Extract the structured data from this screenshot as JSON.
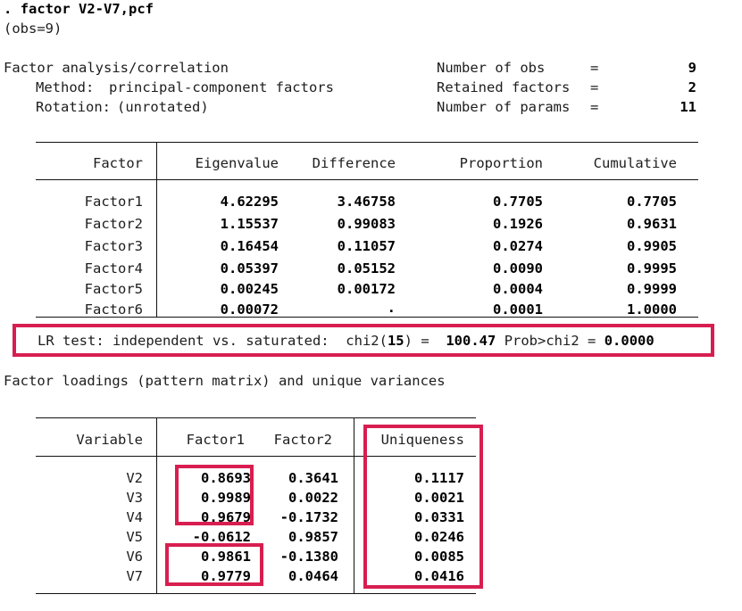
{
  "command": {
    "prompt": ".",
    "text": "factor V2-V7,pcf",
    "obs_line": "(obs=9)"
  },
  "summary": {
    "title": "Factor analysis/correlation",
    "method_label": "Method:",
    "method_value": "principal-component factors",
    "rotation_label": "Rotation:",
    "rotation_value": "(unrotated)",
    "stats": [
      {
        "label": "Number of obs",
        "eq": "=",
        "value": "9"
      },
      {
        "label": "Retained factors",
        "eq": "=",
        "value": "2"
      },
      {
        "label": "Number of params",
        "eq": "=",
        "value": "11"
      }
    ]
  },
  "eigen_table": {
    "headers": [
      "Factor",
      "Eigenvalue",
      "Difference",
      "Proportion",
      "Cumulative"
    ],
    "rows": [
      {
        "factor": "Factor1",
        "eigenvalue": "4.62295",
        "difference": "3.46758",
        "proportion": "0.7705",
        "cumulative": "0.7705"
      },
      {
        "factor": "Factor2",
        "eigenvalue": "1.15537",
        "difference": "0.99083",
        "proportion": "0.1926",
        "cumulative": "0.9631"
      },
      {
        "factor": "Factor3",
        "eigenvalue": "0.16454",
        "difference": "0.11057",
        "proportion": "0.0274",
        "cumulative": "0.9905"
      },
      {
        "factor": "Factor4",
        "eigenvalue": "0.05397",
        "difference": "0.05152",
        "proportion": "0.0090",
        "cumulative": "0.9995"
      },
      {
        "factor": "Factor5",
        "eigenvalue": "0.00245",
        "difference": "0.00172",
        "proportion": "0.0004",
        "cumulative": "0.9999"
      },
      {
        "factor": "Factor6",
        "eigenvalue": "0.00072",
        "difference": ".",
        "proportion": "0.0001",
        "cumulative": "1.0000"
      }
    ]
  },
  "lr_test": {
    "prefix": "LR test: independent vs. saturated:",
    "chi2_label": "chi2(",
    "chi2_df": "15",
    "chi2_close": ")",
    "eq1": "=",
    "chi2_value": "100.47",
    "prob_label": "Prob>chi2",
    "eq2": "=",
    "prob_value": "0.0000"
  },
  "loadings_caption": "Factor loadings (pattern matrix) and unique variances",
  "loadings_table": {
    "headers": [
      "Variable",
      "Factor1",
      "Factor2",
      "Uniqueness"
    ],
    "rows": [
      {
        "variable": "V2",
        "factor1": "0.8693",
        "factor2": "0.3641",
        "uniqueness": "0.1117"
      },
      {
        "variable": "V3",
        "factor1": "0.9989",
        "factor2": "0.0022",
        "uniqueness": "0.0021"
      },
      {
        "variable": "V4",
        "factor1": "0.9679",
        "factor2": "-0.1732",
        "uniqueness": "0.0331"
      },
      {
        "variable": "V5",
        "factor1": "-0.0612",
        "factor2": "0.9857",
        "uniqueness": "0.0246"
      },
      {
        "variable": "V6",
        "factor1": "0.9861",
        "factor2": "-0.1380",
        "uniqueness": "0.0085"
      },
      {
        "variable": "V7",
        "factor1": "0.9779",
        "factor2": "0.0464",
        "uniqueness": "0.0416"
      }
    ]
  },
  "annotations": {
    "color": "#d81e50",
    "boxes": [
      {
        "name": "lr-test-highlight"
      },
      {
        "name": "factor1-v2-v4-highlight"
      },
      {
        "name": "factor1-v6-v7-highlight"
      },
      {
        "name": "uniqueness-column-highlight"
      }
    ]
  }
}
